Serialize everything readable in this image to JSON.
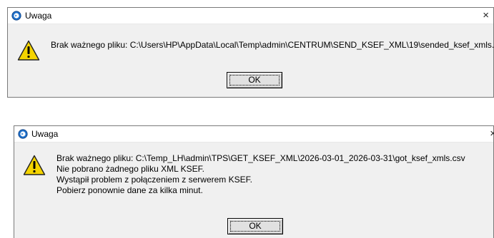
{
  "dialogs": [
    {
      "title": "Uwaga",
      "close_label": "×",
      "message_lines": [
        "Brak ważnego pliku: C:\\Users\\HP\\AppData\\Local\\Temp\\admin\\CENTRUM\\SEND_KSEF_XML\\19\\sended_ksef_xmls.csv"
      ],
      "ok_label": "OK",
      "icons": {
        "app": "app-icon",
        "message": "warning-icon"
      }
    },
    {
      "title": "Uwaga",
      "close_label": "×",
      "message_lines": [
        "Brak ważnego pliku: C:\\Temp_LH\\admin\\TPS\\GET_KSEF_XML\\2026-03-01_2026-03-31\\got_ksef_xmls.csv",
        "Nie pobrano żadnego pliku XML KSEF.",
        "Wystąpił problem z połączeniem z serwerem KSEF.",
        "Pobierz ponownie dane za kilka minut."
      ],
      "ok_label": "OK",
      "icons": {
        "app": "app-icon",
        "message": "warning-icon"
      }
    }
  ],
  "colors": {
    "warning_fill": "#f5d400",
    "dialog_bg": "#f0f0f0",
    "titlebar_bg": "#ffffff",
    "app_icon_blue": "#1e6fc9"
  }
}
